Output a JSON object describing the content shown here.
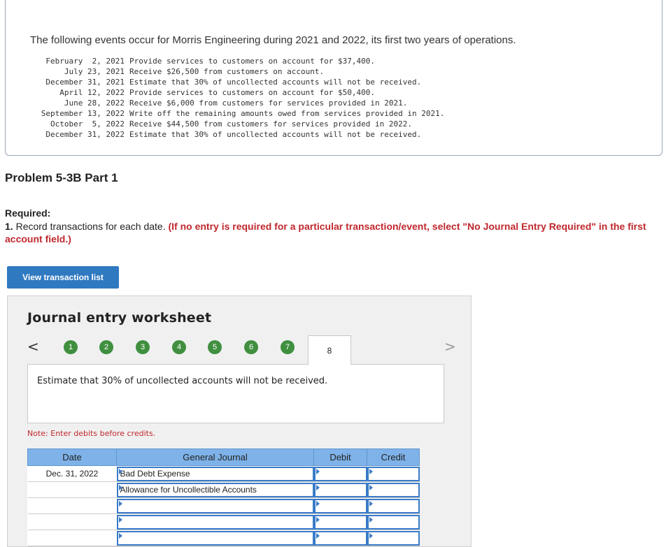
{
  "intro": {
    "text": "The following events occur for Morris Engineering during 2021 and 2022, its first two years of operations.",
    "events": [
      {
        "date": "February  2, 2021",
        "desc": "Provide services to customers on account for $37,400."
      },
      {
        "date": "July 23, 2021",
        "desc": "Receive $26,500 from customers on account."
      },
      {
        "date": "December 31, 2021",
        "desc": "Estimate that 30% of uncollected accounts will not be received."
      },
      {
        "date": "April 12, 2022",
        "desc": "Provide services to customers on account for $50,400."
      },
      {
        "date": "June 28, 2022",
        "desc": "Receive $6,000 from customers for services provided in 2021."
      },
      {
        "date": "September 13, 2022",
        "desc": "Write off the remaining amounts owed from services provided in 2021."
      },
      {
        "date": "October  5, 2022",
        "desc": "Receive $44,500 from customers for services provided in 2022."
      },
      {
        "date": "December 31, 2022",
        "desc": "Estimate that 30% of uncollected accounts will not be received."
      }
    ]
  },
  "problem": {
    "title": "Problem 5-3B Part 1",
    "required_label": "Required:",
    "required_num": "1.",
    "required_text": " Record transactions for each date. ",
    "required_red": "(If no entry is required for a particular transaction/event, select \"No Journal Entry Required\" in the first account field.)"
  },
  "view_button": "View transaction list",
  "worksheet": {
    "title": "Journal entry worksheet",
    "prev_arrow": "<",
    "next_arrow": ">",
    "steps": [
      "1",
      "2",
      "3",
      "4",
      "5",
      "6",
      "7"
    ],
    "active_step": "8",
    "description": "Estimate that 30% of uncollected accounts will not be received.",
    "note": "Note: Enter debits before credits.",
    "table": {
      "headers": {
        "date": "Date",
        "general_journal": "General Journal",
        "debit": "Debit",
        "credit": "Credit"
      },
      "rows": [
        {
          "date": "Dec. 31, 2022",
          "account": "Bad Debt Expense",
          "debit": "",
          "credit": ""
        },
        {
          "date": "",
          "account": "Allowance for Uncollectible Accounts",
          "debit": "",
          "credit": ""
        },
        {
          "date": "",
          "account": "",
          "debit": "",
          "credit": ""
        },
        {
          "date": "",
          "account": "",
          "debit": "",
          "credit": ""
        },
        {
          "date": "",
          "account": "",
          "debit": "",
          "credit": ""
        }
      ]
    }
  }
}
